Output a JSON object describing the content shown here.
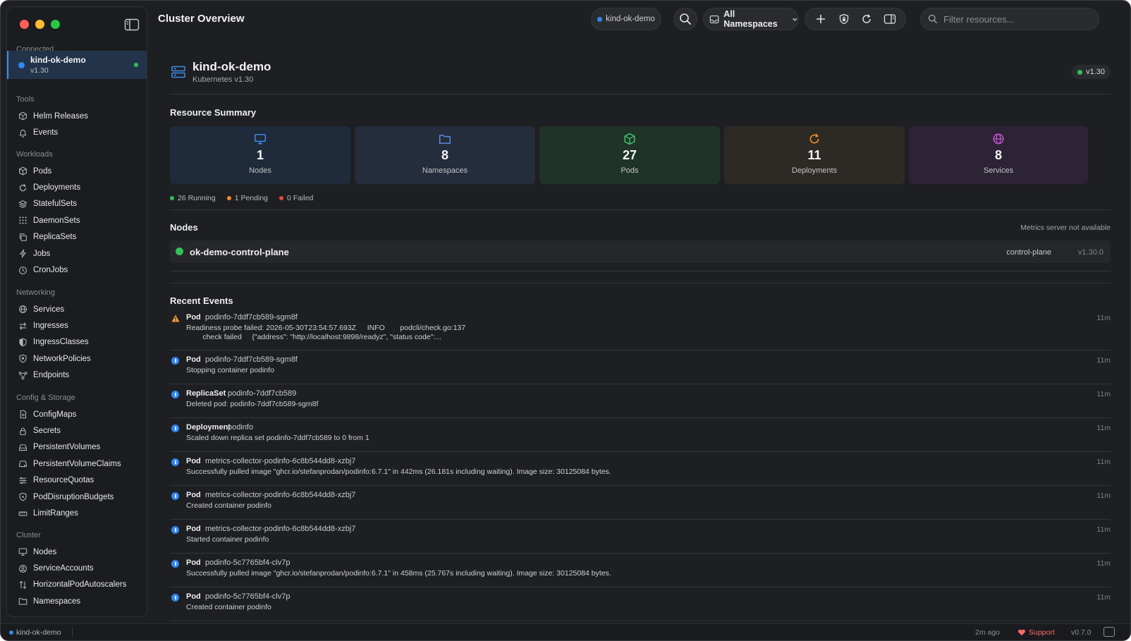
{
  "window": {
    "title": "Cluster Overview"
  },
  "sidebar": {
    "connected_heading": "Connected",
    "cluster": {
      "name": "kind-ok-demo",
      "version": "v1.30"
    },
    "sections": [
      {
        "heading": "Tools",
        "items": [
          {
            "label": "Helm Releases",
            "icon": "helm-icon"
          },
          {
            "label": "Events",
            "icon": "bell-icon"
          }
        ]
      },
      {
        "heading": "Workloads",
        "items": [
          {
            "label": "Pods",
            "icon": "cube-icon"
          },
          {
            "label": "Deployments",
            "icon": "refresh-icon"
          },
          {
            "label": "StatefulSets",
            "icon": "layers-icon"
          },
          {
            "label": "DaemonSets",
            "icon": "grid-icon"
          },
          {
            "label": "ReplicaSets",
            "icon": "copy-icon"
          },
          {
            "label": "Jobs",
            "icon": "bolt-icon"
          },
          {
            "label": "CronJobs",
            "icon": "clock-icon"
          }
        ]
      },
      {
        "heading": "Networking",
        "items": [
          {
            "label": "Services",
            "icon": "globe-icon"
          },
          {
            "label": "Ingresses",
            "icon": "arrows-icon"
          },
          {
            "label": "IngressClasses",
            "icon": "half-shield-icon"
          },
          {
            "label": "NetworkPolicies",
            "icon": "shield-icon"
          },
          {
            "label": "Endpoints",
            "icon": "nodes-icon"
          }
        ]
      },
      {
        "heading": "Config & Storage",
        "items": [
          {
            "label": "ConfigMaps",
            "icon": "file-icon"
          },
          {
            "label": "Secrets",
            "icon": "lock-icon"
          },
          {
            "label": "PersistentVolumes",
            "icon": "drive-icon"
          },
          {
            "label": "PersistentVolumeClaims",
            "icon": "drive-link-icon"
          },
          {
            "label": "ResourceQuotas",
            "icon": "sliders-icon"
          },
          {
            "label": "PodDisruptionBudgets",
            "icon": "shield-check-icon"
          },
          {
            "label": "LimitRanges",
            "icon": "ruler-icon"
          }
        ]
      },
      {
        "heading": "Cluster",
        "items": [
          {
            "label": "Nodes",
            "icon": "monitor-icon"
          },
          {
            "label": "ServiceAccounts",
            "icon": "user-icon"
          },
          {
            "label": "HorizontalPodAutoscalers",
            "icon": "scale-icon"
          },
          {
            "label": "Namespaces",
            "icon": "folder-icon"
          }
        ]
      }
    ]
  },
  "topbar": {
    "title": "Cluster Overview",
    "context": "kind-ok-demo",
    "namespace": "All Namespaces",
    "filter_placeholder": "Filter resources..."
  },
  "cluster_header": {
    "name": "kind-ok-demo",
    "subtitle": "Kubernetes v1.30",
    "version_badge": "v1.30"
  },
  "resource_summary": {
    "title": "Resource Summary",
    "cards": [
      {
        "value": "1",
        "label": "Nodes",
        "icon": "monitor-icon",
        "color": "#3b8ef0",
        "bg": "#1f2b3a"
      },
      {
        "value": "8",
        "label": "Namespaces",
        "icon": "folder-icon",
        "color": "#5e8fe8",
        "bg": "#252c3c"
      },
      {
        "value": "27",
        "label": "Pods",
        "icon": "cube-icon",
        "color": "#3fbf6a",
        "bg": "#1f3329"
      },
      {
        "value": "11",
        "label": "Deployments",
        "icon": "refresh-icon",
        "color": "#f08a2a",
        "bg": "#2d2a25"
      },
      {
        "value": "8",
        "label": "Services",
        "icon": "globe-icon",
        "color": "#c454d8",
        "bg": "#2c2434"
      }
    ],
    "pod_status": {
      "running": "26 Running",
      "pending": "1 Pending",
      "failed": "0 Failed"
    }
  },
  "nodes_section": {
    "title": "Nodes",
    "metrics_note": "Metrics server not available",
    "nodes": [
      {
        "name": "ok-demo-control-plane",
        "role": "control-plane",
        "version": "v1.30.0"
      }
    ]
  },
  "events_section": {
    "title": "Recent Events",
    "events": [
      {
        "type": "warning",
        "kind": "Pod",
        "object": "podinfo-7ddf7cb589-sgm8f",
        "message": "Readiness probe failed: 2026-05-30T23:54:57.693Z\tINFO\tpodcli/check.go:137\n\tcheck failed\t{\"address\": \"http://localhost:9898/readyz\", \"status code\":...",
        "age": "11m"
      },
      {
        "type": "info",
        "kind": "Pod",
        "object": "podinfo-7ddf7cb589-sgm8f",
        "message": "Stopping container podinfo",
        "age": "11m"
      },
      {
        "type": "info",
        "kind": "ReplicaSet",
        "object": "podinfo-7ddf7cb589",
        "message": "Deleted pod: podinfo-7ddf7cb589-sgm8f",
        "age": "11m"
      },
      {
        "type": "info",
        "kind": "Deployment",
        "object": "podinfo",
        "message": "Scaled down replica set podinfo-7ddf7cb589 to 0 from 1",
        "age": "11m"
      },
      {
        "type": "info",
        "kind": "Pod",
        "object": "metrics-collector-podinfo-6c8b544dd8-xzbj7",
        "message": "Successfully pulled image \"ghcr.io/stefanprodan/podinfo:6.7.1\" in 442ms (26.181s including waiting). Image size: 30125084 bytes.",
        "age": "11m"
      },
      {
        "type": "info",
        "kind": "Pod",
        "object": "metrics-collector-podinfo-6c8b544dd8-xzbj7",
        "message": "Created container podinfo",
        "age": "11m"
      },
      {
        "type": "info",
        "kind": "Pod",
        "object": "metrics-collector-podinfo-6c8b544dd8-xzbj7",
        "message": "Started container podinfo",
        "age": "11m"
      },
      {
        "type": "info",
        "kind": "Pod",
        "object": "podinfo-5c7765bf4-clv7p",
        "message": "Successfully pulled image \"ghcr.io/stefanprodan/podinfo:6.7.1\" in 458ms (25.767s including waiting). Image size: 30125084 bytes.",
        "age": "11m"
      },
      {
        "type": "info",
        "kind": "Pod",
        "object": "podinfo-5c7765bf4-clv7p",
        "message": "Created container podinfo",
        "age": "11m"
      }
    ]
  },
  "statusbar": {
    "context": "kind-ok-demo",
    "last_refresh": "2m ago",
    "support": "Support",
    "app_version": "v0.7.0"
  }
}
